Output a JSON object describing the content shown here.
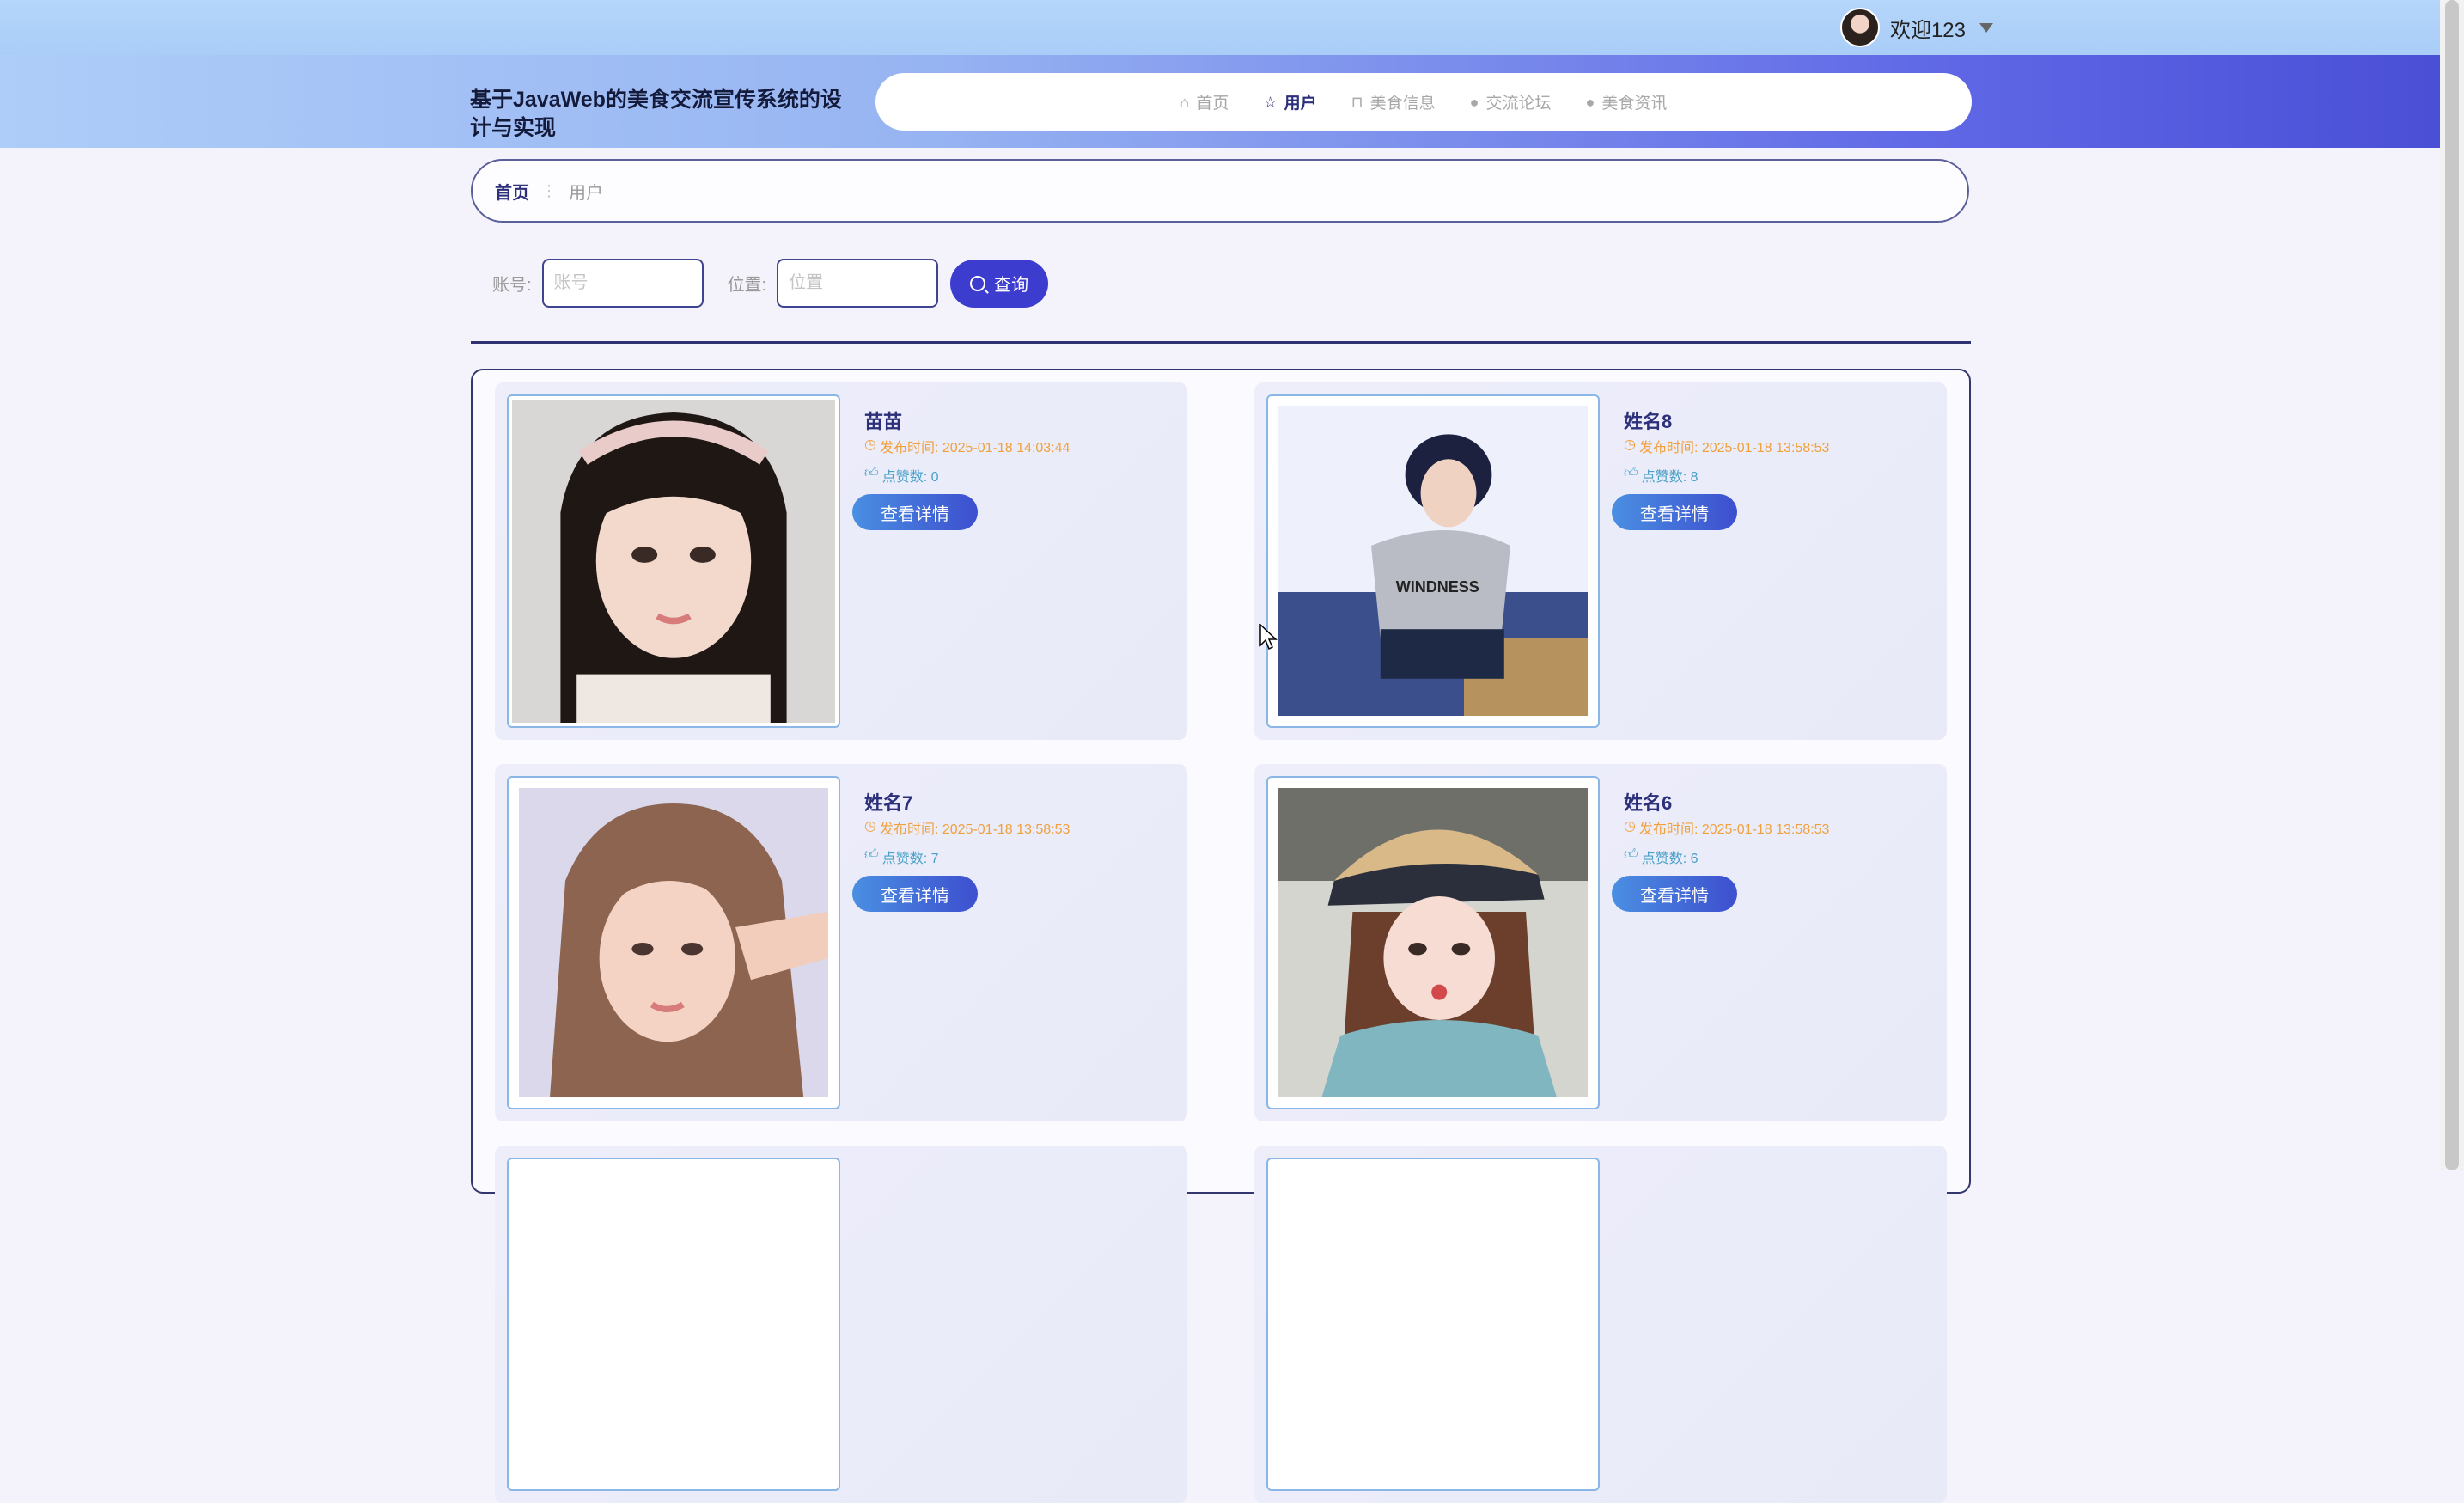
{
  "header": {
    "welcome": "欢迎123",
    "site_title": "基于JavaWeb的美食交流宣传系统的设计与实现",
    "nav": [
      {
        "label": "首页",
        "icon": "home-icon",
        "active": false
      },
      {
        "label": "用户",
        "icon": "star-icon",
        "active": true
      },
      {
        "label": "美食信息",
        "icon": "bag-icon",
        "active": false
      },
      {
        "label": "交流论坛",
        "icon": "info-circle-icon",
        "active": false
      },
      {
        "label": "美食资讯",
        "icon": "info-circle-icon",
        "active": false
      }
    ]
  },
  "breadcrumb": {
    "home": "首页",
    "separator": "⋮",
    "current": "用户"
  },
  "search": {
    "account_label": "账号:",
    "account_placeholder": "账号",
    "location_label": "位置:",
    "location_placeholder": "位置",
    "button": "查询"
  },
  "cards": [
    {
      "name": "苗苗",
      "time": "发布时间: 2025-01-18 14:03:44",
      "likes": "点赞数: 0",
      "button": "查看详情"
    },
    {
      "name": "姓名8",
      "time": "发布时间: 2025-01-18 13:58:53",
      "likes": "点赞数: 8",
      "button": "查看详情"
    },
    {
      "name": "姓名7",
      "time": "发布时间: 2025-01-18 13:58:53",
      "likes": "点赞数: 7",
      "button": "查看详情"
    },
    {
      "name": "姓名6",
      "time": "发布时间: 2025-01-18 13:58:53",
      "likes": "点赞数: 6",
      "button": "查看详情"
    }
  ]
}
